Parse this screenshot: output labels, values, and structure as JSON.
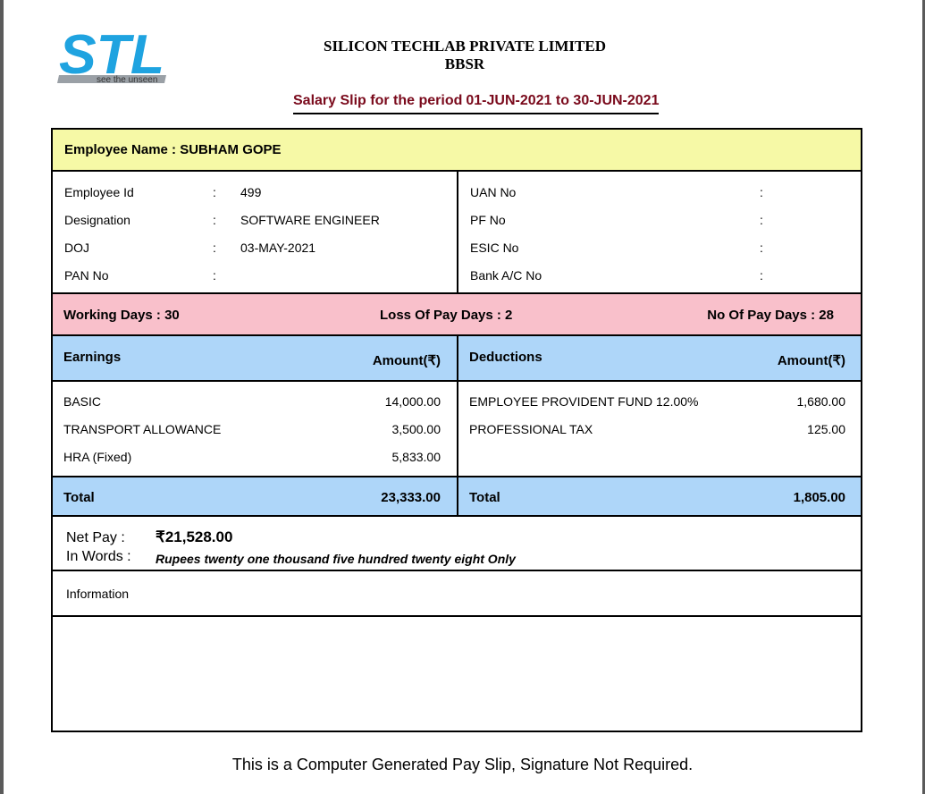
{
  "company": {
    "logo_text": "STL",
    "logo_tagline": "see the unseen",
    "name": "SILICON TECHLAB PRIVATE LIMITED",
    "location": "BBSR"
  },
  "slip": {
    "title_label": "Salary Slip for the period",
    "period": "01-JUN-2021 to 30-JUN-2021"
  },
  "employee": {
    "name_label": "Employee Name :",
    "name": "SUBHAM GOPE"
  },
  "details_left": [
    {
      "label": "Employee Id",
      "value": "499"
    },
    {
      "label": "Designation",
      "value": "SOFTWARE ENGINEER"
    },
    {
      "label": "DOJ",
      "value": "03-MAY-2021"
    },
    {
      "label": "PAN No",
      "value": ""
    }
  ],
  "details_right": [
    {
      "label": "UAN No",
      "value": ""
    },
    {
      "label": "PF No",
      "value": ""
    },
    {
      "label": "ESIC No",
      "value": ""
    },
    {
      "label": "Bank A/C No",
      "value": ""
    }
  ],
  "separator": ":",
  "days": {
    "working": "Working Days : 30",
    "lop": "Loss Of Pay Days : 2",
    "paid": "No Of Pay Days : 28"
  },
  "earnings": {
    "header": "Earnings",
    "amount_header": "Amount(₹)",
    "items": [
      {
        "name": "BASIC",
        "amount": "14,000.00"
      },
      {
        "name": "TRANSPORT ALLOWANCE",
        "amount": "3,500.00"
      },
      {
        "name": "HRA (Fixed)",
        "amount": "5,833.00"
      }
    ],
    "total_label": "Total",
    "total": "23,333.00"
  },
  "deductions": {
    "header": "Deductions",
    "amount_header": "Amount(₹)",
    "items": [
      {
        "name": "EMPLOYEE PROVIDENT FUND 12.00%",
        "amount": "1,680.00"
      },
      {
        "name": "PROFESSIONAL TAX",
        "amount": "125.00"
      }
    ],
    "total_label": "Total",
    "total": "1,805.00"
  },
  "net": {
    "label": "Net Pay :",
    "value": "₹21,528.00",
    "words_label": "In Words :",
    "words": "Rupees twenty one thousand five hundred twenty eight Only"
  },
  "information_label": "Information",
  "footer": "This is a Computer Generated Pay Slip, Signature Not Required.",
  "colors": {
    "name_bg": "#f6f9a6",
    "days_bg": "#f9c0cb",
    "header_bg": "#aed6f9",
    "logo_blue": "#1fa3e0",
    "period_text": "#7a0a1c"
  }
}
